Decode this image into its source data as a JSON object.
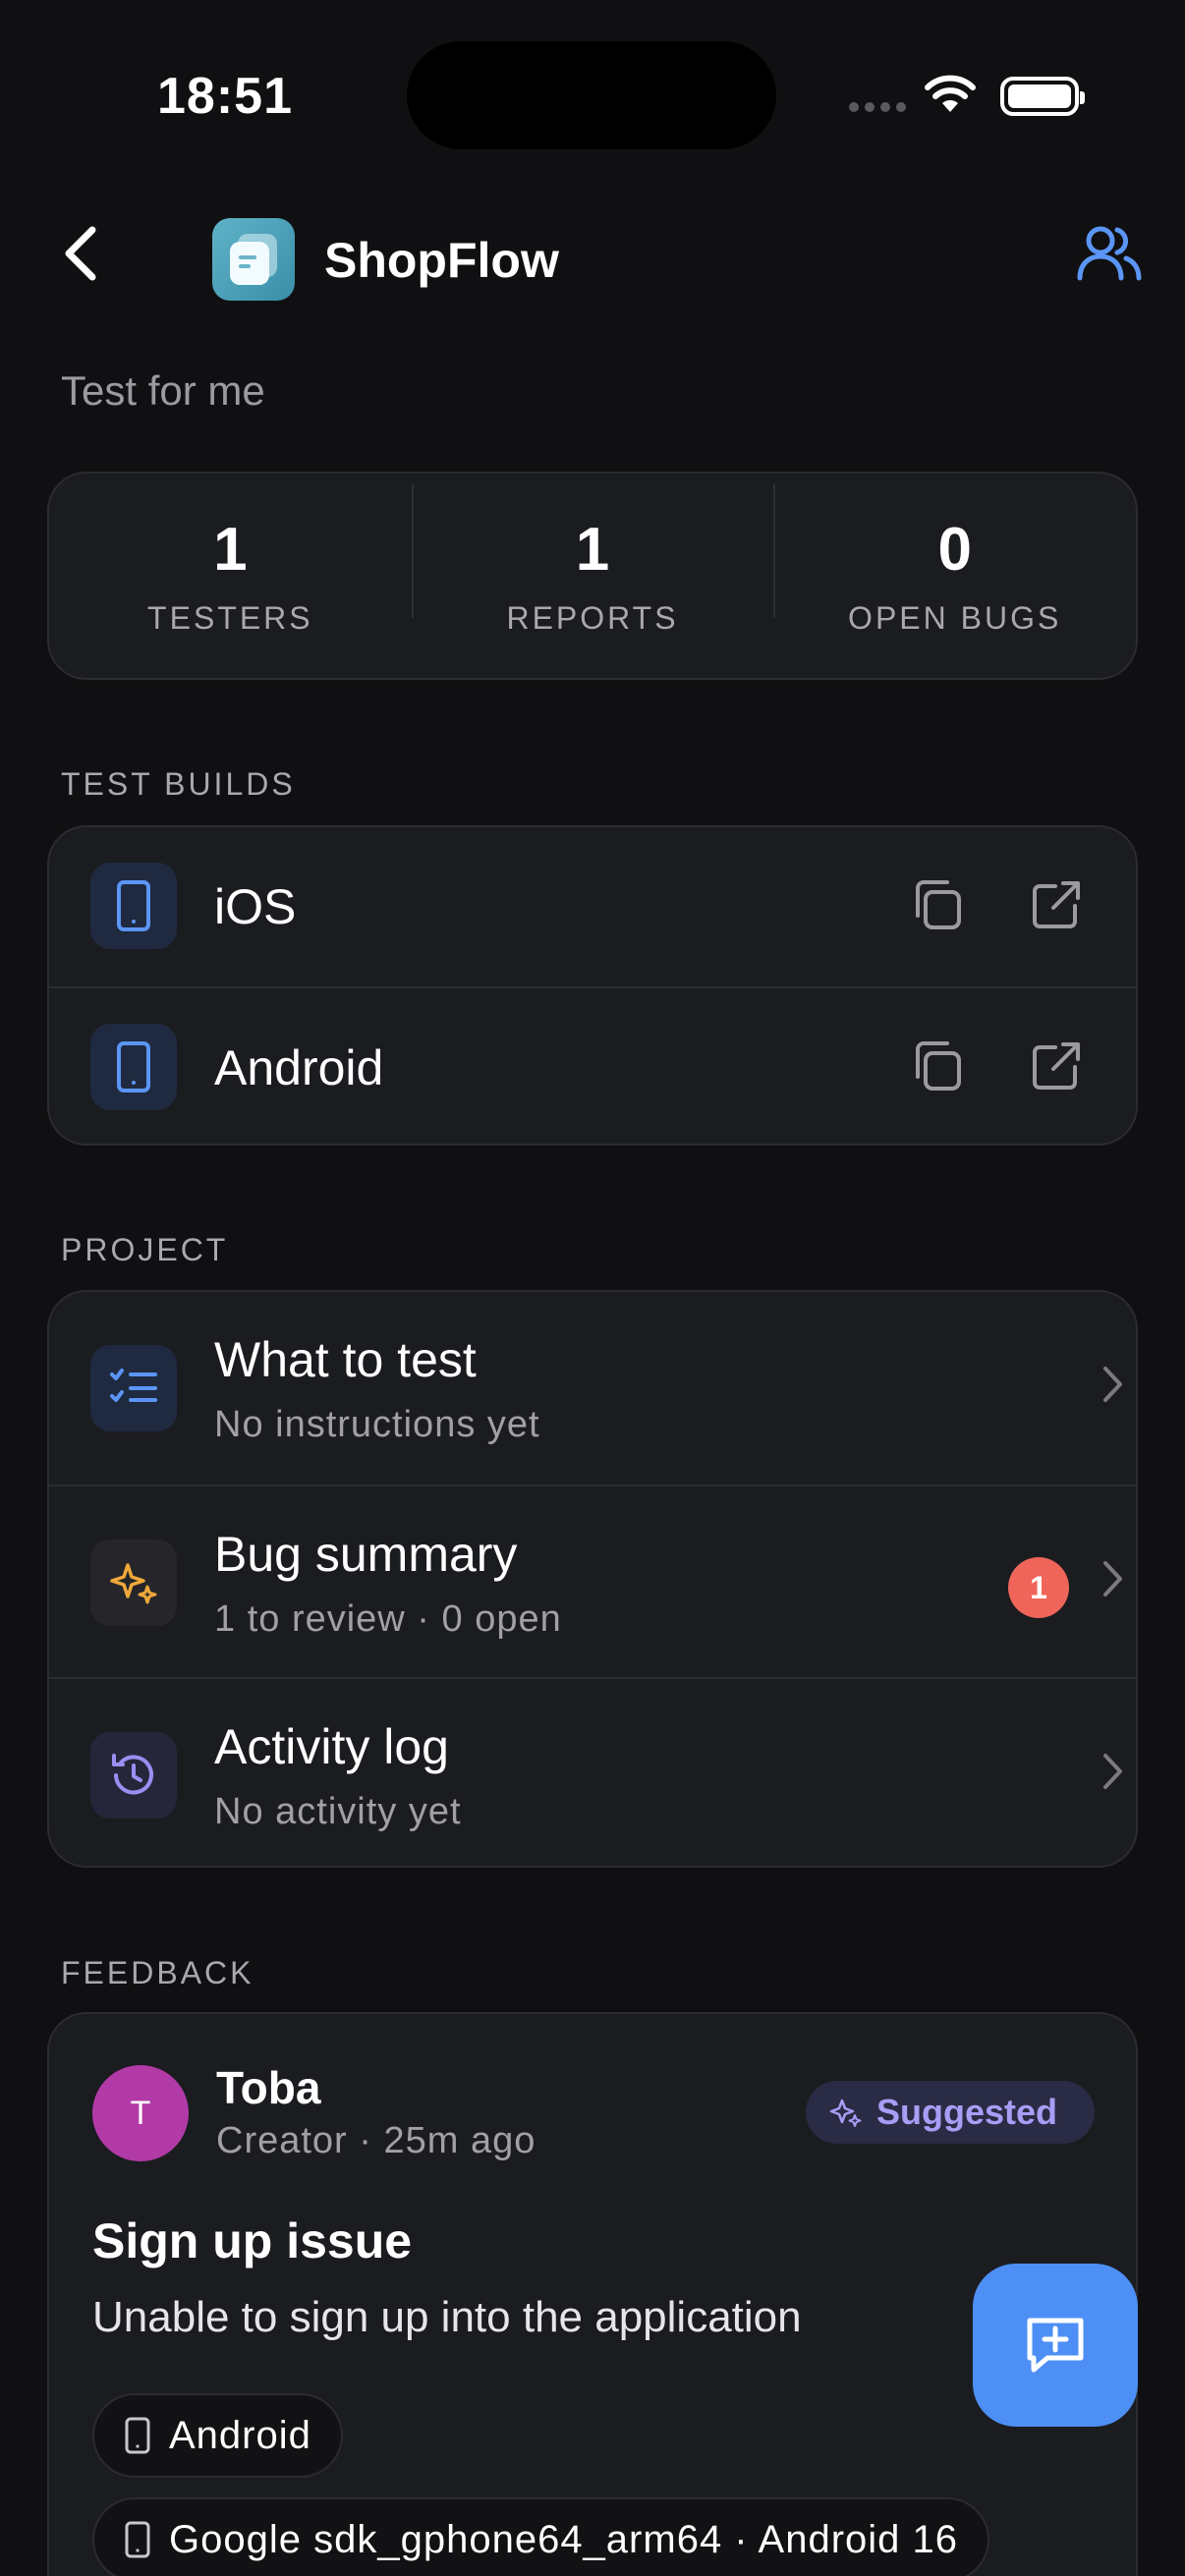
{
  "status_bar": {
    "time": "18:51"
  },
  "header": {
    "app_name": "ShopFlow",
    "subtitle": "Test for me"
  },
  "stats": [
    {
      "value": "1",
      "label": "TESTERS"
    },
    {
      "value": "1",
      "label": "REPORTS"
    },
    {
      "value": "0",
      "label": "OPEN BUGS"
    }
  ],
  "test_builds": {
    "section_label": "TEST BUILDS",
    "items": [
      {
        "name": "iOS",
        "icon": "phone-icon"
      },
      {
        "name": "Android",
        "icon": "phone-icon"
      }
    ]
  },
  "project": {
    "section_label": "PROJECT",
    "items": [
      {
        "title": "What to test",
        "subtitle": "No instructions yet",
        "icon": "checklist-icon"
      },
      {
        "title": "Bug summary",
        "subtitle": "1 to review · 0 open",
        "icon": "sparkles-icon",
        "badge": "1"
      },
      {
        "title": "Activity log",
        "subtitle": "No activity yet",
        "icon": "history-icon"
      }
    ]
  },
  "feedback": {
    "section_label": "FEEDBACK",
    "item": {
      "avatar_initial": "T",
      "author": "Toba",
      "meta": "Creator · 25m ago",
      "tag": "Suggested",
      "title": "Sign up issue",
      "description": "Unable to sign up into the application",
      "chips": [
        "Android",
        "Google sdk_gphone64_arm64 · Android 16"
      ]
    }
  },
  "colors": {
    "background": "#101012",
    "card": "#1b1c20",
    "accent": "#4d8ff5",
    "badge": "#f0655a",
    "suggested": "#a99df5",
    "avatar": "#b23aa6"
  }
}
